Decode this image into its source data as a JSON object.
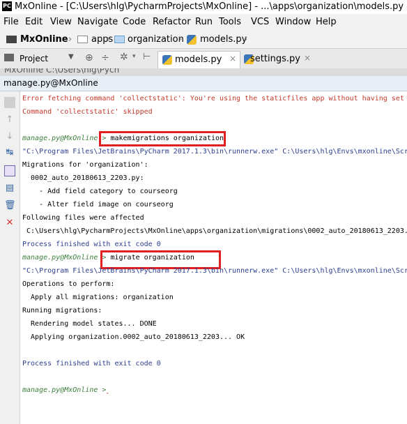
{
  "window": {
    "title": "MxOnline - [C:\\Users\\hlg\\PycharmProjects\\MxOnline] - ...\\apps\\organization\\models.py - PyCharm",
    "logo": "PC"
  },
  "menu": [
    "File",
    "Edit",
    "View",
    "Navigate",
    "Code",
    "Refactor",
    "Run",
    "Tools",
    "VCS",
    "Window",
    "Help"
  ],
  "breadcrumb": [
    "MxOnline",
    "apps",
    "organization",
    "models.py"
  ],
  "project_combo": "Project",
  "tabs": [
    "models.py",
    "settings.py"
  ],
  "run_panel": {
    "header": "MxOnline  C:\\Users\\hlg\\Pych",
    "title": "manage.py@MxOnline"
  },
  "console": {
    "error1": "Error fetching command 'collectstatic': You're using the staticfiles app without having set",
    "error2": "Command 'collectstatic' skipped",
    "prompt1": "manage.py@MxOnline",
    "cmd1": "makemigrations organization",
    "exec1": "\"C:\\Program Files\\JetBrains\\PyCharm 2017.1.3\\bin\\runnerw.exe\" C:\\Users\\hlg\\Envs\\mxonline\\Scr",
    "out1": "Migrations for 'organization':",
    "out2": "  0002_auto_20180613_2203.py:",
    "out3": "    - Add field category to courseorg",
    "out4": "    - Alter field image on courseorg",
    "out5": "Following files were affected",
    "out6": " C:\\Users\\hlg\\PycharmProjects\\MxOnline\\apps\\organization\\migrations\\0002_auto_20180613_2203.",
    "finish1": "Process finished with exit code 0",
    "prompt2": "manage.py@MxOnline",
    "cmd2": "migrate organization",
    "exec2": "\"C:\\Program Files\\JetBrains\\PyCharm 2017.1.3\\bin\\runnerw.exe\" C:\\Users\\hlg\\Envs\\mxonline\\Scr",
    "out7": "Operations to perform:",
    "out8": "  Apply all migrations: organization",
    "out9": "Running migrations:",
    "out10": "  Rendering model states... DONE",
    "out11": "  Applying organization.0002_auto_20180613_2203... OK",
    "finish2": "Process finished with exit code 0",
    "prompt3": "manage.py@MxOnline"
  },
  "icons": {
    "rerun": "rerun-icon",
    "up": "arrow-up-icon",
    "down": "arrow-down-icon",
    "softwrap": "soft-wrap-icon",
    "scroll": "scroll-to-end-icon",
    "print": "print-icon",
    "clear": "trash-icon",
    "close": "close-icon"
  },
  "colors": {
    "error": "#c0392b",
    "prompt": "#3d7f3d",
    "link": "#2c3e8f",
    "highlight": "#e02020"
  }
}
